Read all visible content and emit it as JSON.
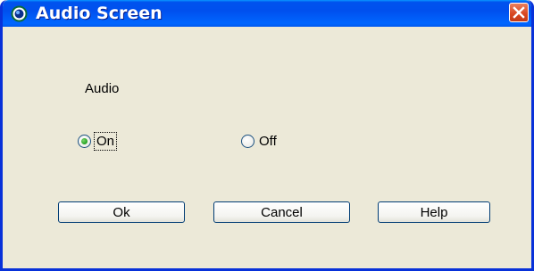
{
  "window": {
    "title": "Audio Screen",
    "icon": "app-logo-icon",
    "close_icon": "close-icon"
  },
  "audio_group": {
    "label": "Audio",
    "options": [
      {
        "label": "On",
        "selected": true
      },
      {
        "label": "Off",
        "selected": false
      }
    ]
  },
  "buttons": {
    "ok": "Ok",
    "cancel": "Cancel",
    "help": "Help"
  },
  "colors": {
    "titlebar": "#0053ee",
    "frame": "#0831d9",
    "dialog_bg": "#ece9d8",
    "close": "#d8461f",
    "radio_selected": "#21a121"
  }
}
